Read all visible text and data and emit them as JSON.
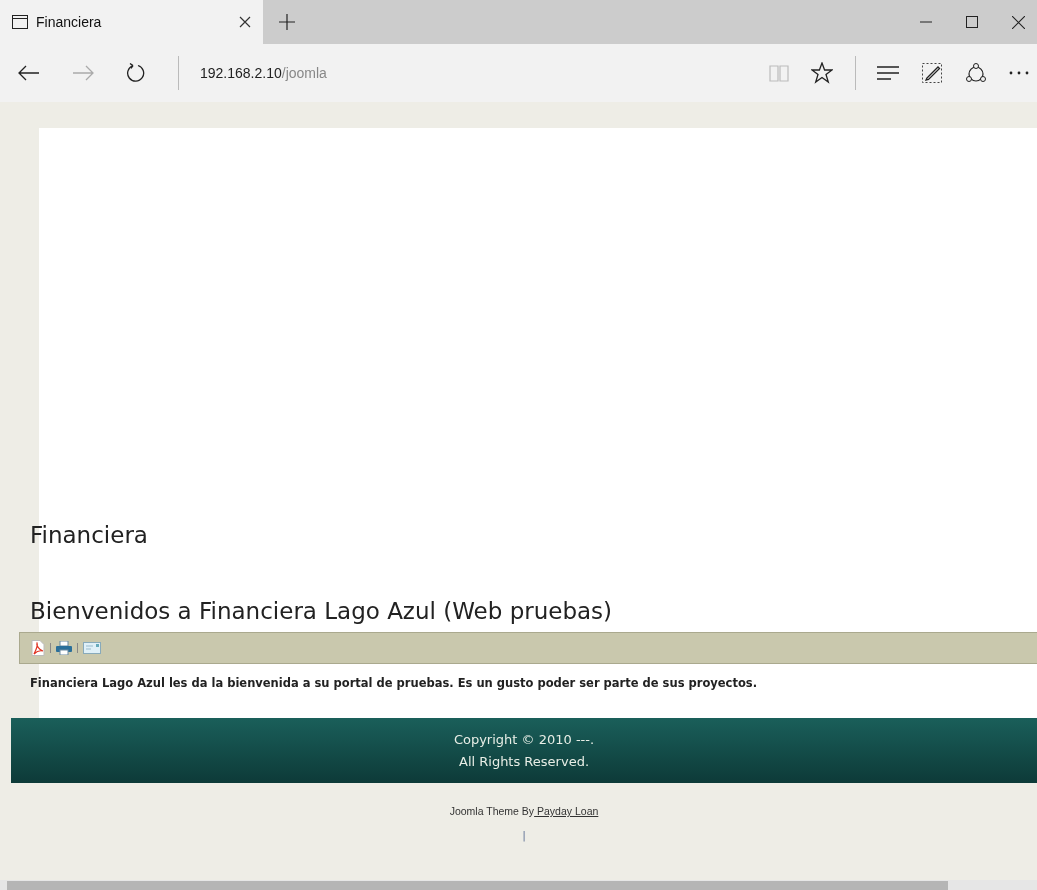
{
  "tab": {
    "title": "Financiera",
    "selected": true
  },
  "address": {
    "host": "192.168.2.10",
    "path": "/joomla"
  },
  "page": {
    "site_title": "Financiera",
    "article_title": "Bienvenidos a Financiera Lago Azul (Web pruebas)",
    "article_text": "Financiera Lago Azul les da la bienvenida a su portal de pruebas. Es un gusto poder ser parte de sus proyectos."
  },
  "footer": {
    "lines": [
      "Copyright © 2010 ---.",
      "All Rights Reserved."
    ],
    "credit": "Joomla Theme By",
    "credit_link": " Payday Loan",
    "separator": "|"
  }
}
